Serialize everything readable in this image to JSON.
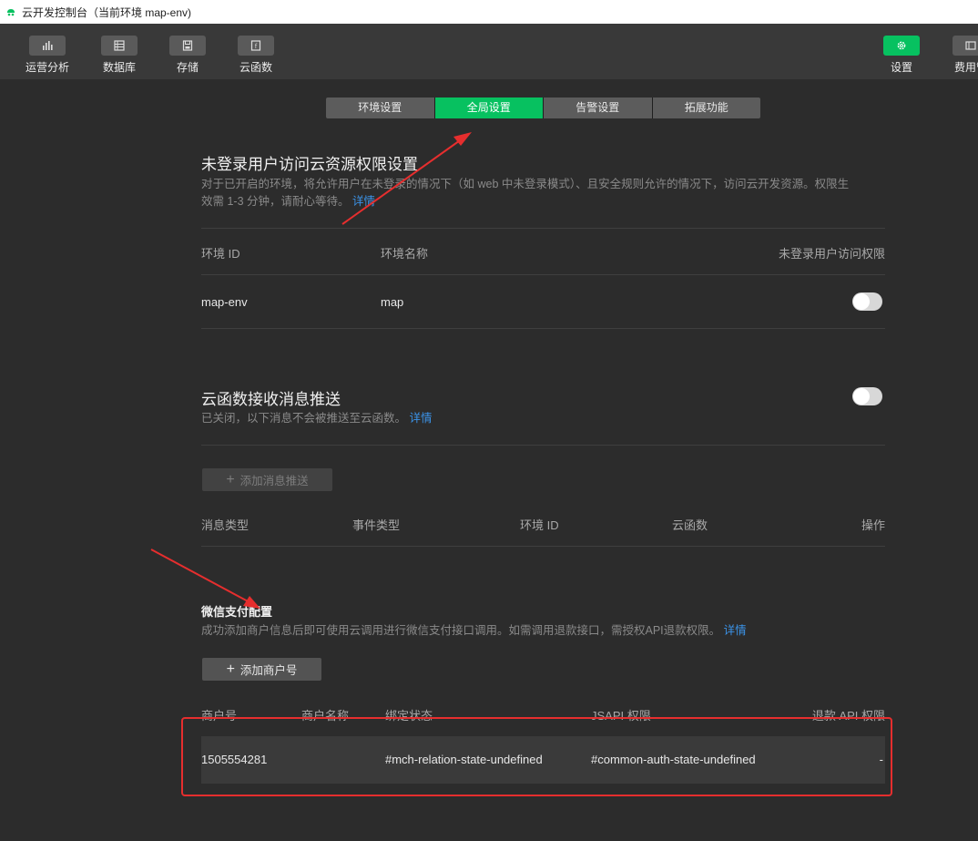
{
  "window": {
    "title": "云开发控制台（当前环境 map-env)"
  },
  "toolbar": {
    "items": [
      {
        "label": "运营分析",
        "icon": "bar-chart-icon"
      },
      {
        "label": "数据库",
        "icon": "database-icon"
      },
      {
        "label": "存储",
        "icon": "storage-icon"
      },
      {
        "label": "云函数",
        "icon": "cloud-function-icon"
      }
    ],
    "settings_label": "设置",
    "billing_label": "费用管"
  },
  "tabs": [
    "环境设置",
    "全局设置",
    "告警设置",
    "拓展功能"
  ],
  "active_tab": "全局设置",
  "section_auth": {
    "title": "未登录用户访问云资源权限设置",
    "desc_line1": "对于已开启的环境，将允许用户在未登录的情况下（如 web 中未登录模式）、且安全规则允许的情况下，访问云开发资源。权限生",
    "desc_line2": "效需 1-3 分钟，请耐心等待。",
    "link": "详情",
    "headers": [
      "环境 ID",
      "环境名称",
      "未登录用户访问权限"
    ],
    "row": {
      "env_id": "map-env",
      "env_name": "map",
      "enabled": false
    }
  },
  "section_push": {
    "title": "云函数接收消息推送",
    "desc": "已关闭，以下消息不会被推送至云函数。",
    "link": "详情",
    "enabled": false,
    "add_button": "添加消息推送",
    "headers": [
      "消息类型",
      "事件类型",
      "环境 ID",
      "云函数",
      "操作"
    ]
  },
  "section_pay": {
    "title": "微信支付配置",
    "desc": "成功添加商户信息后即可使用云调用进行微信支付接口调用。如需调用退款接口，需授权API退款权限。",
    "link": "详情",
    "add_button": "添加商户号",
    "headers": [
      "商户号",
      "商户名称",
      "绑定状态",
      "JSAPI 权限",
      "退款 API 权限"
    ],
    "row": {
      "merchant_id": "1505554281",
      "merchant_name": "",
      "bind_state": "#mch-relation-state-undefined",
      "jsapi": "#common-auth-state-undefined",
      "refund": "-"
    }
  },
  "colors": {
    "accent": "#07c160",
    "link": "#3b93e8",
    "annotation": "#e62e2e"
  }
}
